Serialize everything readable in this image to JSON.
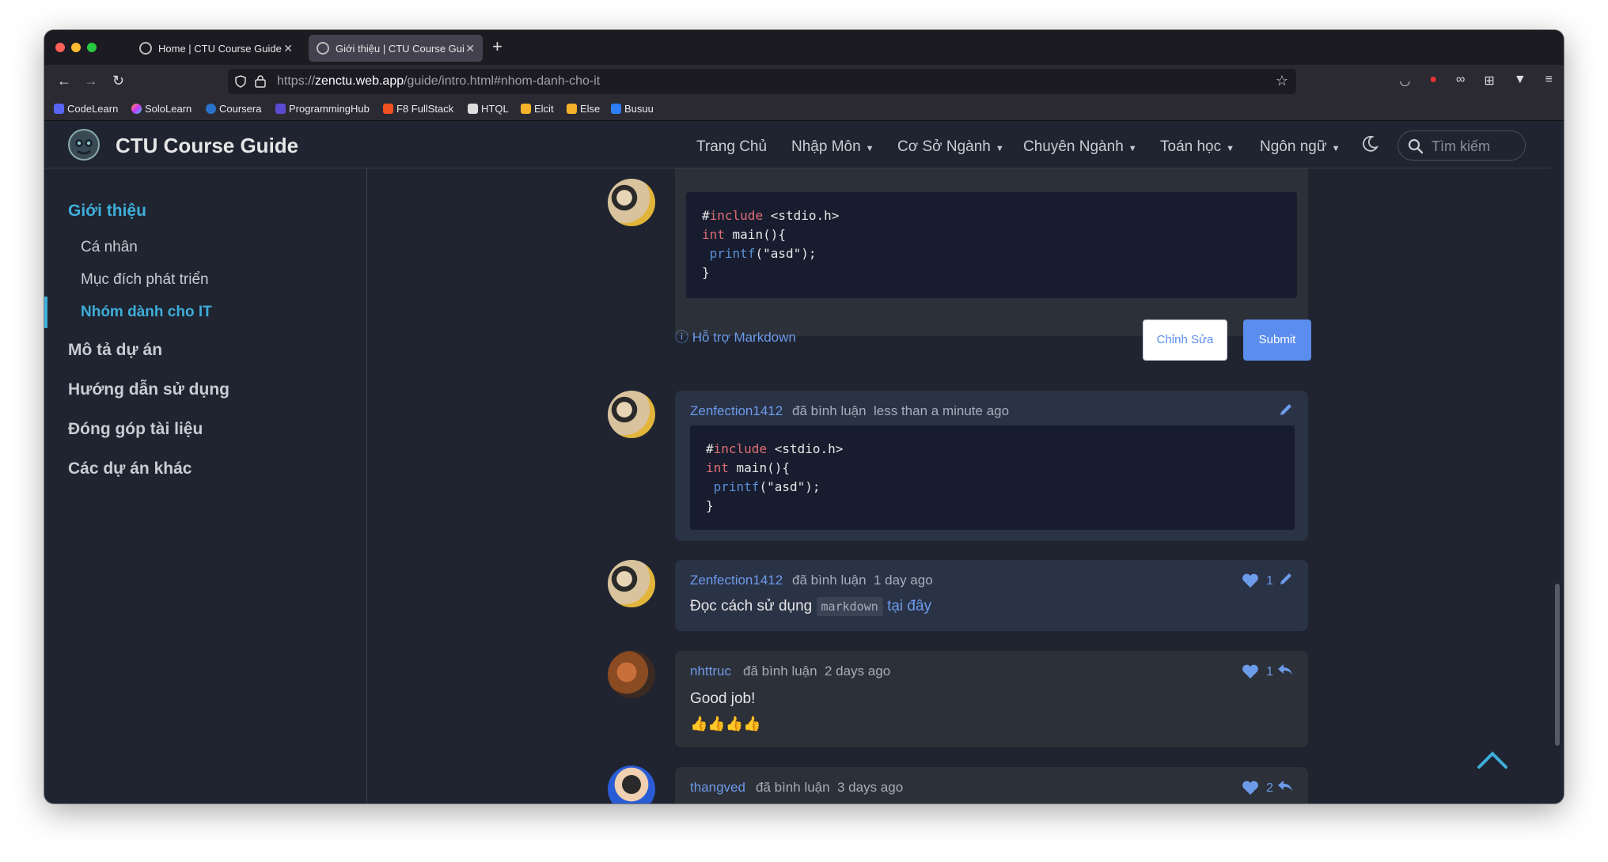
{
  "browser": {
    "tabs": [
      {
        "title": "Home | CTU Course Guide",
        "active": false
      },
      {
        "title": "Giới thiệu | CTU Course Gui",
        "active": true
      }
    ],
    "url_prefix": "https://",
    "url_domain": "zenctu.web.app",
    "url_path": "/guide/intro.html#nhom-danh-cho-it",
    "bookmarks": [
      "CodeLearn",
      "SoloLearn",
      "Coursera",
      "ProgrammingHub",
      "F8 FullStack",
      "HTQL",
      "Elcit",
      "Else",
      "Busuu"
    ]
  },
  "site": {
    "title": "CTU Course Guide",
    "nav": [
      "Trang Chủ",
      "Nhập Môn",
      "Cơ Sở Ngành",
      "Chuyên Ngành",
      "Toán học",
      "Ngôn ngữ"
    ],
    "search_placeholder": "Tìm kiếm"
  },
  "sidebar": {
    "section_title": "Giới thiệu",
    "subitems": [
      "Cá nhân",
      "Mục đích phát triển",
      "Nhóm dành cho IT"
    ],
    "active_subitem": "Nhóm dành cho IT",
    "sections": [
      "Mô tả dự án",
      "Hướng dẫn sử dụng",
      "Đóng góp tài liệu",
      "Các dự án khác"
    ]
  },
  "editor": {
    "code": {
      "line1_hash": "#",
      "line1_kw": "include",
      "line1_rest": " <stdio.h>",
      "line2_kw": "int",
      "line2_rest": " main(){",
      "line3_call": " printf",
      "line3_rest": "(\"asd\");",
      "line4": "}"
    },
    "markdown_hint": "Hỗ trợ Markdown",
    "edit_button": "Chỉnh Sửa",
    "submit_button": "Submit"
  },
  "comments": [
    {
      "user": "Zenfection1412",
      "action": "đã bình luận",
      "time": "less than a minute ago"
    },
    {
      "user": "Zenfection1412",
      "action": "đã bình luận",
      "time": "1 day ago",
      "likes": "1",
      "text_before": "Đọc cách sử dụng",
      "code_word": "markdown",
      "link": "tại đây"
    },
    {
      "user": "nhttruc",
      "action": "đã bình luận",
      "time": "2 days ago",
      "likes": "1",
      "text": "Good job!",
      "emoji": "👍👍👍👍"
    },
    {
      "user": "thangved",
      "action": "đã bình luận",
      "time": "3 days ago",
      "likes": "2"
    }
  ],
  "colors": {
    "accent": "#3eaed9",
    "link": "#6c9bea",
    "submit": "#5b8dee",
    "background": "#1f2430"
  }
}
